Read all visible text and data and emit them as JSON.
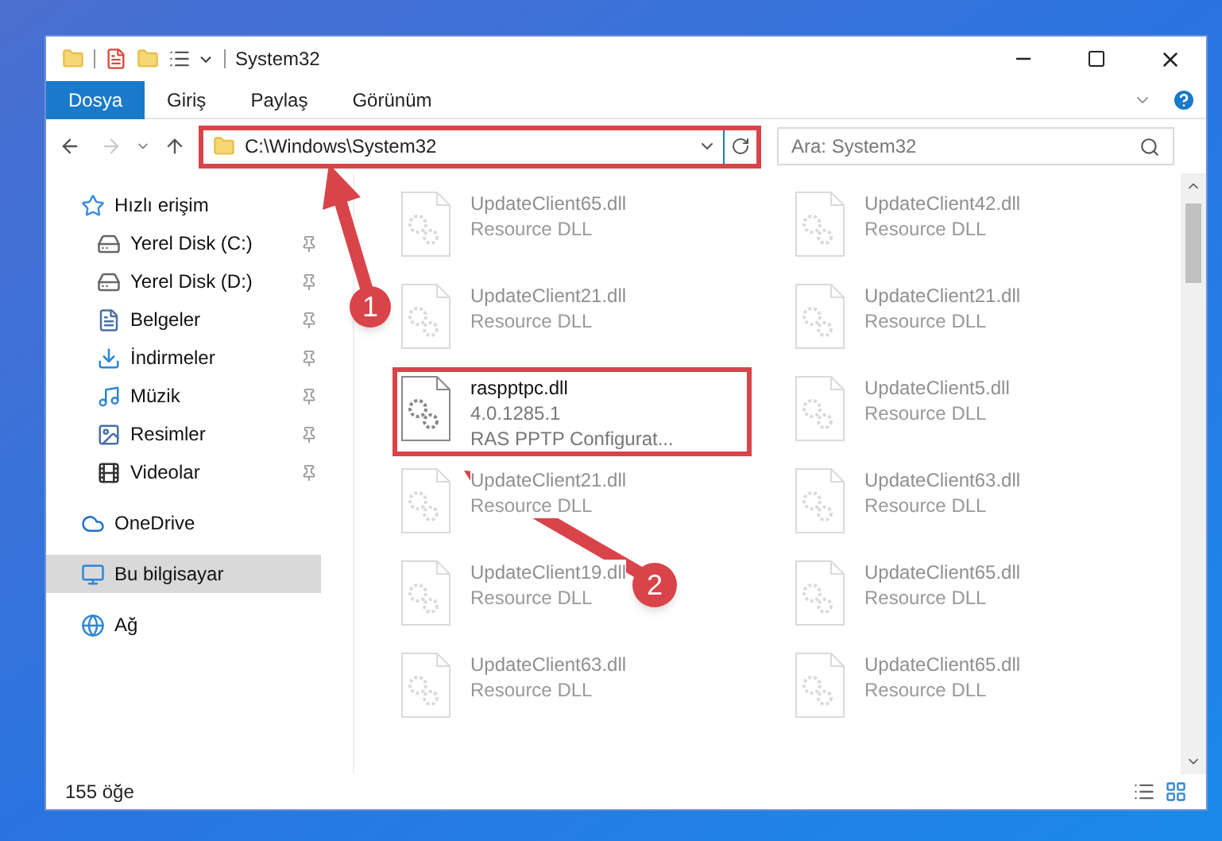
{
  "window": {
    "title": "System32"
  },
  "ribbon_tabs": [
    {
      "label": "Dosya",
      "selected": true
    },
    {
      "label": "Giriş",
      "selected": false
    },
    {
      "label": "Paylaş",
      "selected": false
    },
    {
      "label": "Görünüm",
      "selected": false
    }
  ],
  "address": {
    "path": "C:\\Windows\\System32",
    "highlighted": true
  },
  "search": {
    "placeholder": "Ara: System32"
  },
  "sidebar": [
    {
      "label": "Hızlı erişim",
      "kind": "star",
      "selected": false,
      "children": [
        {
          "label": "Yerel Disk (C:)",
          "kind": "drive",
          "pinned": true
        },
        {
          "label": "Yerel Disk (D:)",
          "kind": "drive",
          "pinned": true
        },
        {
          "label": "Belgeler",
          "kind": "documents",
          "pinned": true
        },
        {
          "label": "İndirmeler",
          "kind": "downloads",
          "pinned": true
        },
        {
          "label": "Müzik",
          "kind": "music",
          "pinned": true
        },
        {
          "label": "Resimler",
          "kind": "pictures",
          "pinned": true
        },
        {
          "label": "Videolar",
          "kind": "videos",
          "pinned": true
        }
      ]
    },
    {
      "label": "OneDrive",
      "kind": "cloud",
      "selected": false
    },
    {
      "label": "Bu bilgisayar",
      "kind": "computer",
      "selected": true
    },
    {
      "label": "Ağ",
      "kind": "network",
      "selected": false
    }
  ],
  "files": [
    {
      "name": "UpdateClient65.dll",
      "lines": [
        "Resource DLL"
      ],
      "highlighted": false
    },
    {
      "name": "UpdateClient42.dll",
      "lines": [
        "Resource DLL"
      ],
      "highlighted": false
    },
    {
      "name": "UpdateClient21.dll",
      "lines": [
        "Resource DLL"
      ],
      "highlighted": false
    },
    {
      "name": "UpdateClient21.dll",
      "lines": [
        "Resource DLL"
      ],
      "highlighted": false
    },
    {
      "name": "raspptpc.dll",
      "lines": [
        "4.0.1285.1",
        "RAS PPTP Configurat..."
      ],
      "highlighted": true
    },
    {
      "name": "UpdateClient5.dll",
      "lines": [
        "Resource DLL"
      ],
      "highlighted": false
    },
    {
      "name": "UpdateClient21.dll",
      "lines": [
        "Resource DLL"
      ],
      "highlighted": false
    },
    {
      "name": "UpdateClient63.dll",
      "lines": [
        "Resource DLL"
      ],
      "highlighted": false
    },
    {
      "name": "UpdateClient19.dll",
      "lines": [
        "Resource DLL"
      ],
      "highlighted": false
    },
    {
      "name": "UpdateClient65.dll",
      "lines": [
        "Resource DLL"
      ],
      "highlighted": false
    },
    {
      "name": "UpdateClient63.dll",
      "lines": [
        "Resource DLL"
      ],
      "highlighted": false
    },
    {
      "name": "UpdateClient65.dll",
      "lines": [
        "Resource DLL"
      ],
      "highlighted": false
    }
  ],
  "status_bar": {
    "count": "155 öğe"
  },
  "annotations": [
    {
      "label": "1"
    },
    {
      "label": "2"
    }
  ]
}
